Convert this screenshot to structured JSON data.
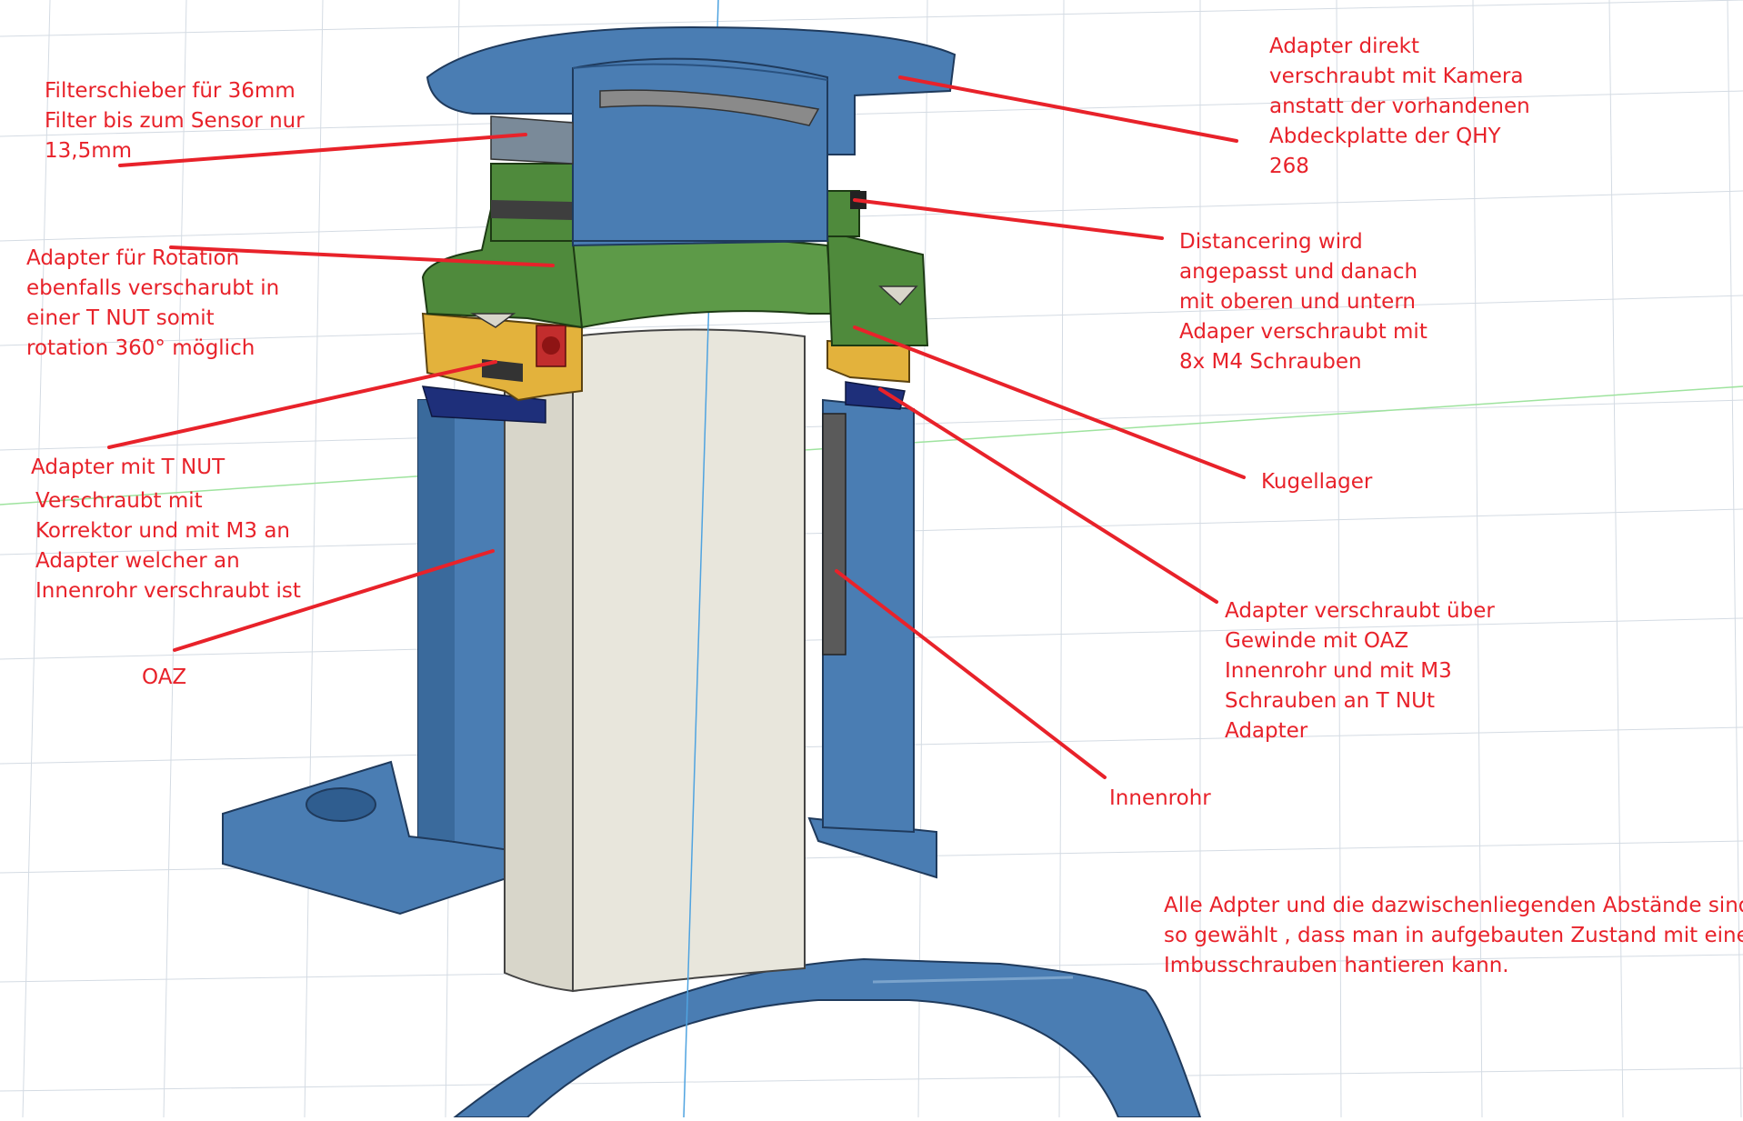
{
  "colors": {
    "annotation": "#e8222a",
    "blue_part": "#4a7db3",
    "blue_dark": "#2f5d8f",
    "green_part": "#4f8a3c",
    "yellow_part": "#e3b23c",
    "tube": "#e8e6dc",
    "grid": "#d4dbe3"
  },
  "annotations": [
    {
      "id": "filterschieber",
      "lines": [
        "Filterschieber für 36mm",
        "Filter bis zum Sensor nur",
        "13,5mm"
      ]
    },
    {
      "id": "adapter-kamera",
      "lines": [
        "Adapter direkt",
        "verschraubt mit Kamera",
        "anstatt der vorhandenen",
        "Abdeckplatte der QHY",
        "268"
      ]
    },
    {
      "id": "adapter-rotation",
      "lines": [
        "Adapter für Rotation",
        "ebenfalls verscharubt in",
        "einer T NUT somit",
        "rotation 360° möglich"
      ]
    },
    {
      "id": "distancering",
      "lines": [
        "Distancering wird",
        "angepasst und danach",
        "mit oberen und untern",
        "Adaper verschraubt mit",
        "8x M4 Schrauben"
      ]
    },
    {
      "id": "adapter-tnut",
      "lines": [
        "Adapter mit T NUT"
      ]
    },
    {
      "id": "verschraubt-korrektor",
      "lines": [
        "Verschraubt mit",
        "Korrektor und mit M3 an",
        "Adapter welcher an",
        "Innenrohr verschraubt ist"
      ]
    },
    {
      "id": "kugellager",
      "lines": [
        "Kugellager"
      ]
    },
    {
      "id": "oaz",
      "lines": [
        "OAZ"
      ]
    },
    {
      "id": "adapter-gewinde",
      "lines": [
        "Adapter verschraubt über",
        "Gewinde mit OAZ",
        "Innenrohr und mit M3",
        "Schrauben an T NUt",
        "Adapter"
      ]
    },
    {
      "id": "innenrohr",
      "lines": [
        "Innenrohr"
      ]
    },
    {
      "id": "abstaende",
      "lines": [
        "Alle Adpter und die dazwischenliegenden Abstände sind",
        "so gewählt , dass man in aufgebauten Zustand mit einem",
        "Imbusschrauben hantieren kann."
      ]
    }
  ]
}
